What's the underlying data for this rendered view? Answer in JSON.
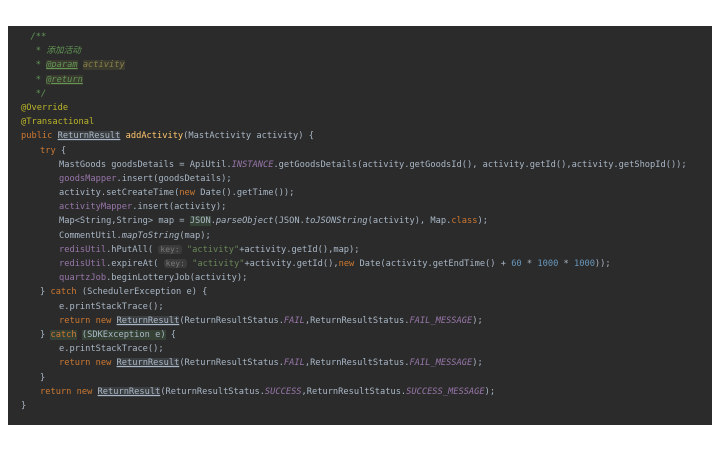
{
  "code_lines": [
    {
      "indent": 1,
      "segs": [
        {
          "t": "/**",
          "c": "c-comment"
        }
      ]
    },
    {
      "indent": 1,
      "segs": [
        {
          "t": " * 添加活动",
          "c": "c-comment"
        }
      ]
    },
    {
      "indent": 1,
      "segs": [
        {
          "t": " * ",
          "c": "c-comment"
        },
        {
          "t": "@param",
          "c": "c-doctag"
        },
        {
          "t": " ",
          "c": "c-comment"
        },
        {
          "t": "activity",
          "c": "c-param"
        }
      ]
    },
    {
      "indent": 1,
      "segs": [
        {
          "t": " * ",
          "c": "c-comment"
        },
        {
          "t": "@return",
          "c": "c-doctag"
        }
      ]
    },
    {
      "indent": 1,
      "segs": [
        {
          "t": " */",
          "c": "c-comment"
        }
      ]
    },
    {
      "indent": 0,
      "segs": [
        {
          "t": "@Override",
          "c": "c-anno"
        }
      ]
    },
    {
      "indent": 0,
      "segs": [
        {
          "t": "@Transactional",
          "c": "c-anno"
        }
      ]
    },
    {
      "indent": 0,
      "segs": [
        {
          "t": "public ",
          "c": "c-kw"
        },
        {
          "t": "ReturnResult",
          "c": "c-hl2"
        },
        {
          "t": " ",
          "c": "c-plain"
        },
        {
          "t": "addActivity",
          "c": "c-method"
        },
        {
          "t": "(MastActivity activity) {",
          "c": "c-plain"
        }
      ]
    },
    {
      "indent": 2,
      "segs": [
        {
          "t": "try ",
          "c": "c-kw"
        },
        {
          "t": "{",
          "c": "c-plain"
        }
      ]
    },
    {
      "indent": 4,
      "segs": [
        {
          "t": "MastGoods goodsDetails = ApiUtil.",
          "c": "c-plain"
        },
        {
          "t": "INSTANCE",
          "c": "c-static-field"
        },
        {
          "t": ".getGoodsDetails(activity.getGoodsId(), activity.getId(),activity.getShopId());",
          "c": "c-plain"
        }
      ]
    },
    {
      "indent": 4,
      "segs": [
        {
          "t": "goodsMapper",
          "c": "c-field"
        },
        {
          "t": ".insert(goodsDetails);",
          "c": "c-plain"
        }
      ]
    },
    {
      "indent": 4,
      "segs": [
        {
          "t": "activity.setCreateTime(",
          "c": "c-plain"
        },
        {
          "t": "new ",
          "c": "c-kw"
        },
        {
          "t": "Date().getTime());",
          "c": "c-plain"
        }
      ]
    },
    {
      "indent": 4,
      "segs": [
        {
          "t": "activityMapper",
          "c": "c-field"
        },
        {
          "t": ".insert(activity);",
          "c": "c-plain"
        }
      ]
    },
    {
      "indent": 4,
      "segs": [
        {
          "t": "Map<String,String> map = ",
          "c": "c-plain"
        },
        {
          "t": "JSON",
          "c": "c-hl"
        },
        {
          "t": ".",
          "c": "c-plain"
        },
        {
          "t": "parseObject",
          "c": "c-static-method"
        },
        {
          "t": "(JSON.",
          "c": "c-plain"
        },
        {
          "t": "toJSONString",
          "c": "c-static-method"
        },
        {
          "t": "(activity), Map.",
          "c": "c-plain"
        },
        {
          "t": "class",
          "c": "c-kw"
        },
        {
          "t": ");",
          "c": "c-plain"
        }
      ]
    },
    {
      "indent": 4,
      "segs": [
        {
          "t": "CommentUtil.",
          "c": "c-plain"
        },
        {
          "t": "mapToString",
          "c": "c-static-method"
        },
        {
          "t": "(map);",
          "c": "c-plain"
        }
      ]
    },
    {
      "indent": 4,
      "segs": [
        {
          "t": "redisUtil",
          "c": "c-field"
        },
        {
          "t": ".hPutAll( ",
          "c": "c-plain"
        },
        {
          "t": "key:",
          "c": "c-hint"
        },
        {
          "t": " ",
          "c": "c-plain"
        },
        {
          "t": "\"activity\"",
          "c": "c-str"
        },
        {
          "t": "+activity.getId(),map);",
          "c": "c-plain"
        }
      ]
    },
    {
      "indent": 4,
      "segs": [
        {
          "t": "redisUtil",
          "c": "c-field"
        },
        {
          "t": ".expireAt( ",
          "c": "c-plain"
        },
        {
          "t": "key:",
          "c": "c-hint"
        },
        {
          "t": " ",
          "c": "c-plain"
        },
        {
          "t": "\"activity\"",
          "c": "c-str"
        },
        {
          "t": "+activity.getId(),",
          "c": "c-plain"
        },
        {
          "t": "new ",
          "c": "c-kw"
        },
        {
          "t": "Date(activity.getEndTime() + ",
          "c": "c-plain"
        },
        {
          "t": "60",
          "c": "c-num"
        },
        {
          "t": " * ",
          "c": "c-plain"
        },
        {
          "t": "1000",
          "c": "c-num"
        },
        {
          "t": " * ",
          "c": "c-plain"
        },
        {
          "t": "1000",
          "c": "c-num"
        },
        {
          "t": "));",
          "c": "c-plain"
        }
      ]
    },
    {
      "indent": 4,
      "segs": [
        {
          "t": "quartzJob",
          "c": "c-field"
        },
        {
          "t": ".beginLotteryJob(activity);",
          "c": "c-plain"
        }
      ]
    },
    {
      "indent": 2,
      "segs": [
        {
          "t": "} ",
          "c": "c-plain"
        },
        {
          "t": "catch ",
          "c": "c-kw"
        },
        {
          "t": "(SchedulerException e) {",
          "c": "c-plain"
        }
      ]
    },
    {
      "indent": 4,
      "segs": [
        {
          "t": "e.printStackTrace();",
          "c": "c-plain"
        }
      ]
    },
    {
      "indent": 4,
      "segs": [
        {
          "t": "return new ",
          "c": "c-kw"
        },
        {
          "t": "ReturnResult",
          "c": "c-hl2"
        },
        {
          "t": "(ReturnResultStatus.",
          "c": "c-plain"
        },
        {
          "t": "FAIL",
          "c": "c-static-field"
        },
        {
          "t": ",ReturnResultStatus.",
          "c": "c-plain"
        },
        {
          "t": "FAIL_MESSAGE",
          "c": "c-static-field"
        },
        {
          "t": ");",
          "c": "c-plain"
        }
      ]
    },
    {
      "indent": 2,
      "segs": [
        {
          "t": "} ",
          "c": "c-plain"
        },
        {
          "t": "catch",
          "c": "c-kw c-hl"
        },
        {
          "t": " ",
          "c": "c-plain"
        },
        {
          "t": "(SDKException e)",
          "c": "c-hl"
        },
        {
          "t": " {",
          "c": "c-plain"
        }
      ]
    },
    {
      "indent": 4,
      "segs": [
        {
          "t": "e.printStackTrace();",
          "c": "c-plain"
        }
      ]
    },
    {
      "indent": 4,
      "segs": [
        {
          "t": "return new ",
          "c": "c-kw"
        },
        {
          "t": "ReturnResult",
          "c": "c-hl2"
        },
        {
          "t": "(ReturnResultStatus.",
          "c": "c-plain"
        },
        {
          "t": "FAIL",
          "c": "c-static-field"
        },
        {
          "t": ",ReturnResultStatus.",
          "c": "c-plain"
        },
        {
          "t": "FAIL_MESSAGE",
          "c": "c-static-field"
        },
        {
          "t": ");",
          "c": "c-plain"
        }
      ]
    },
    {
      "indent": 2,
      "segs": [
        {
          "t": "}",
          "c": "c-plain"
        }
      ]
    },
    {
      "indent": 2,
      "segs": [
        {
          "t": "return new ",
          "c": "c-kw"
        },
        {
          "t": "ReturnResult",
          "c": "c-hl2"
        },
        {
          "t": "(ReturnResultStatus.",
          "c": "c-plain"
        },
        {
          "t": "SUCCESS",
          "c": "c-static-field"
        },
        {
          "t": ",ReturnResultStatus.",
          "c": "c-plain"
        },
        {
          "t": "SUCCESS_MESSAGE",
          "c": "c-static-field"
        },
        {
          "t": ");",
          "c": "c-plain"
        }
      ]
    },
    {
      "indent": 0,
      "segs": [
        {
          "t": "}",
          "c": "c-plain"
        }
      ]
    }
  ]
}
